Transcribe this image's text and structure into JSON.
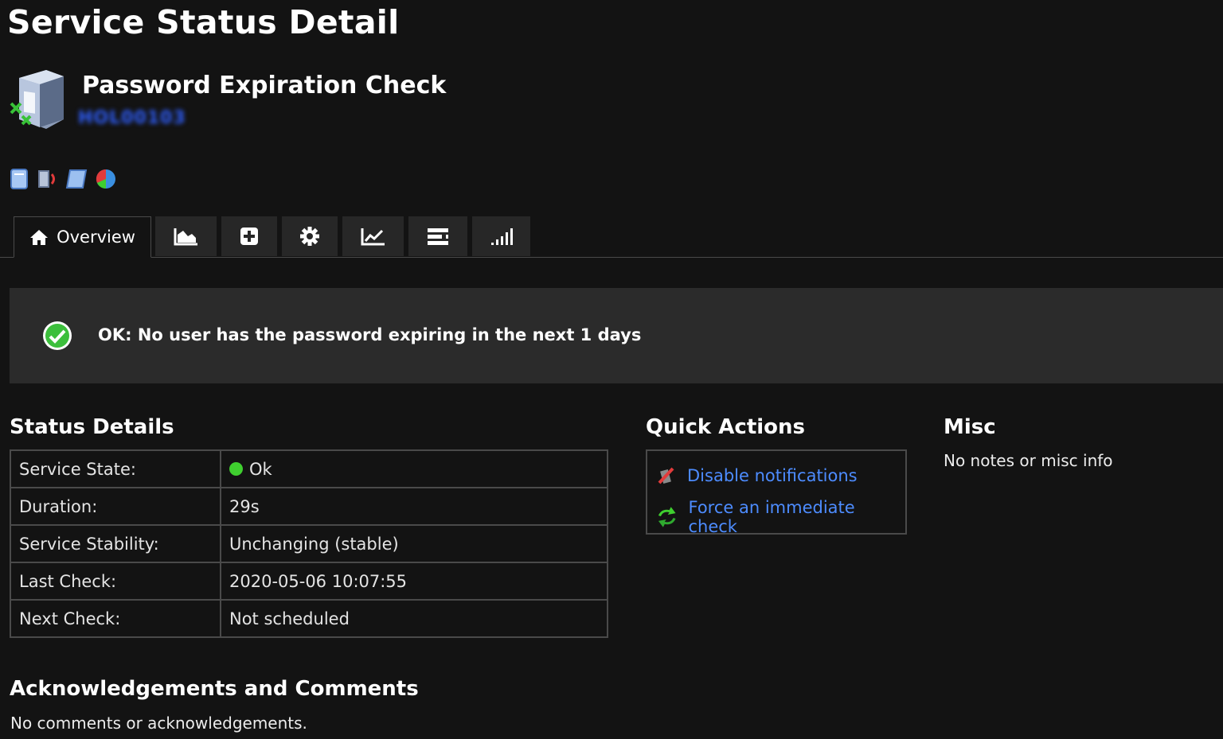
{
  "page": {
    "title": "Service Status Detail"
  },
  "service": {
    "name": "Password Expiration Check",
    "host": "HOL00103"
  },
  "tabs": [
    {
      "label": "Overview",
      "icon": "home-icon"
    },
    {
      "icon": "area-chart-icon"
    },
    {
      "icon": "plus-square-icon"
    },
    {
      "icon": "gear-icon"
    },
    {
      "icon": "line-chart-icon"
    },
    {
      "icon": "list-icon"
    },
    {
      "icon": "signal-bars-icon"
    }
  ],
  "status": {
    "text": "OK: No user has the password expiring in the next 1 days",
    "color": "#3fcf2f"
  },
  "status_details": {
    "heading": "Status Details",
    "rows": [
      {
        "label": "Service State:",
        "value": "Ok"
      },
      {
        "label": "Duration:",
        "value": "29s"
      },
      {
        "label": "Service Stability:",
        "value": "Unchanging (stable)"
      },
      {
        "label": "Last Check:",
        "value": "2020-05-06 10:07:55"
      },
      {
        "label": "Next Check:",
        "value": "Not scheduled"
      }
    ]
  },
  "quick_actions": {
    "heading": "Quick Actions",
    "items": [
      {
        "label": "Disable notifications",
        "icon": "notification-off-icon"
      },
      {
        "label": "Force an immediate check",
        "icon": "refresh-icon"
      }
    ]
  },
  "misc": {
    "heading": "Misc",
    "text": "No notes or misc info"
  },
  "acknowledgements": {
    "heading": "Acknowledgements and Comments",
    "text": "No comments or acknowledgements."
  },
  "colors": {
    "link": "#4d8cff",
    "banner_bg": "#2b2b2b",
    "page_bg": "#131313"
  }
}
